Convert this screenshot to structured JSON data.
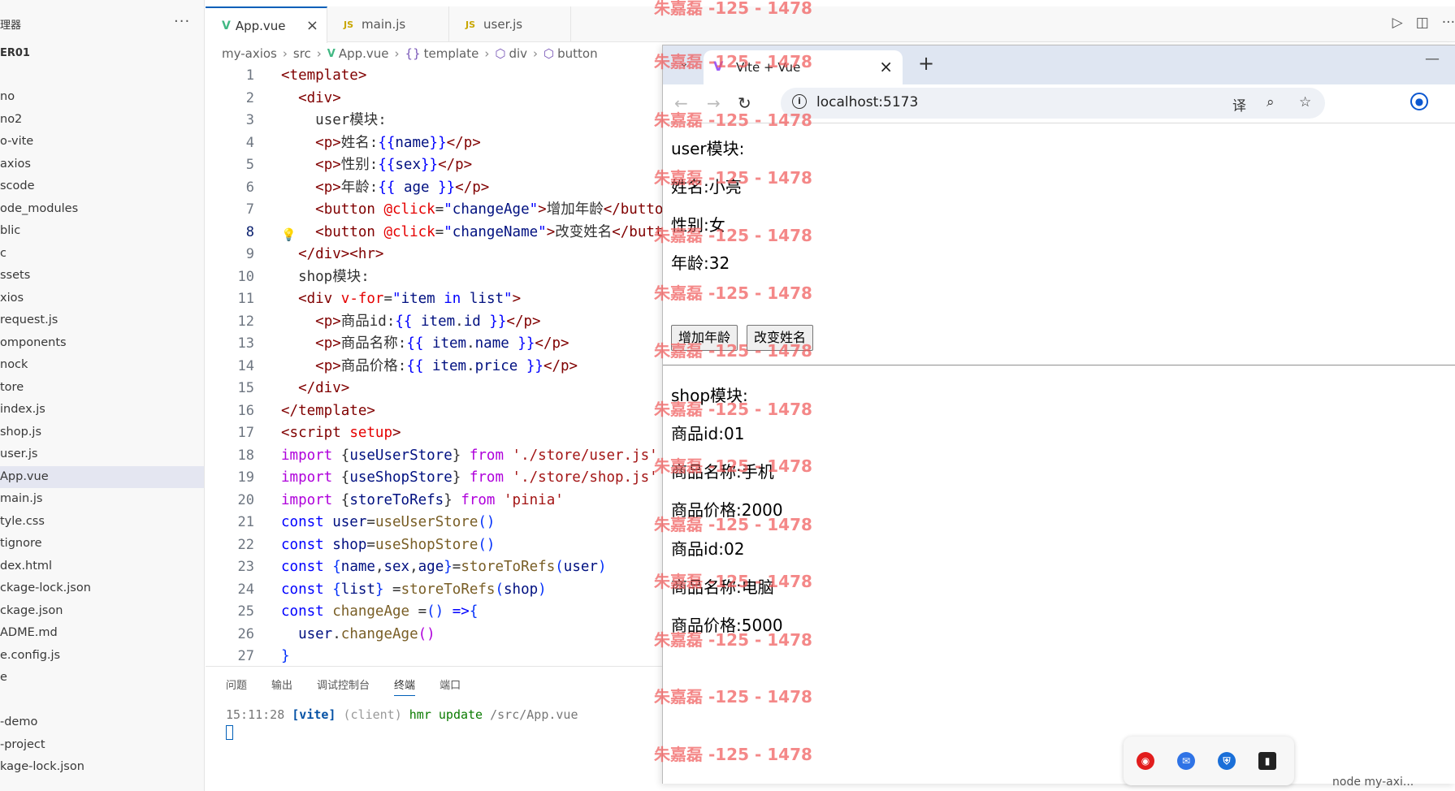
{
  "sidebar": {
    "title": "理器",
    "more": "···",
    "project": "ER01",
    "items": [
      {
        "label": "no"
      },
      {
        "label": "no2"
      },
      {
        "label": "o-vite"
      },
      {
        "label": "axios"
      },
      {
        "label": "scode"
      },
      {
        "label": "ode_modules"
      },
      {
        "label": "blic"
      },
      {
        "label": "c"
      },
      {
        "label": "ssets"
      },
      {
        "label": "xios"
      },
      {
        "label": " request.js"
      },
      {
        "label": "omponents"
      },
      {
        "label": "nock"
      },
      {
        "label": "tore"
      },
      {
        "label": " index.js"
      },
      {
        "label": " shop.js"
      },
      {
        "label": " user.js"
      },
      {
        "label": "App.vue",
        "active": true
      },
      {
        "label": "main.js"
      },
      {
        "label": "tyle.css"
      },
      {
        "label": "tignore"
      },
      {
        "label": "dex.html"
      },
      {
        "label": "ckage-lock.json"
      },
      {
        "label": "ckage.json"
      },
      {
        "label": "ADME.md"
      },
      {
        "label": "e.config.js"
      },
      {
        "label": "e"
      },
      {
        "label": ""
      },
      {
        "label": "-demo"
      },
      {
        "label": "-project"
      },
      {
        "label": "kage-lock.json"
      }
    ]
  },
  "tabs": [
    {
      "label": "App.vue",
      "active": true
    },
    {
      "label": "main.js"
    },
    {
      "label": "user.js"
    }
  ],
  "breadcrumb": [
    "my-axios",
    "src",
    "App.vue",
    "template",
    "div",
    "button"
  ],
  "code": {
    "current_line": 8,
    "lines": [
      "1",
      "2",
      "3",
      "4",
      "5",
      "6",
      "7",
      "8",
      "9",
      "10",
      "11",
      "12",
      "13",
      "14",
      "15",
      "16",
      "17",
      "18",
      "19",
      "20",
      "21",
      "22",
      "23",
      "24",
      "25",
      "26",
      "27"
    ]
  },
  "panel": {
    "tabs": [
      "问题",
      "输出",
      "调试控制台",
      "终端",
      "端口"
    ],
    "active_tab": "终端",
    "terminal": {
      "time": "15:11:28",
      "tag": "[vite]",
      "client": "(client)",
      "msg": "hmr update",
      "path": "/src/App.vue"
    }
  },
  "browser": {
    "tab_title": "Vite + Vue",
    "url": "localhost:5173",
    "page": {
      "user_heading": "user模块:",
      "name_line": "姓名:小亮",
      "sex_line": "性别:女",
      "age_line": "年龄:32",
      "btn_age": "增加年龄",
      "btn_name": "改变姓名",
      "shop_heading": "shop模块:",
      "items": [
        {
          "id_line": "商品id:01",
          "name_line": "商品名称:手机",
          "price_line": "商品价格:2000"
        },
        {
          "id_line": "商品id:02",
          "name_line": "商品名称:电脑",
          "price_line": "商品价格:5000"
        }
      ]
    }
  },
  "taskbar": {
    "label": "node  my-axi..."
  },
  "watermark": "朱嘉磊 -125 - 1478",
  "colors": {
    "accent": "#005fb8",
    "vue_green": "#41b883",
    "watermark": "#f05a5a"
  }
}
